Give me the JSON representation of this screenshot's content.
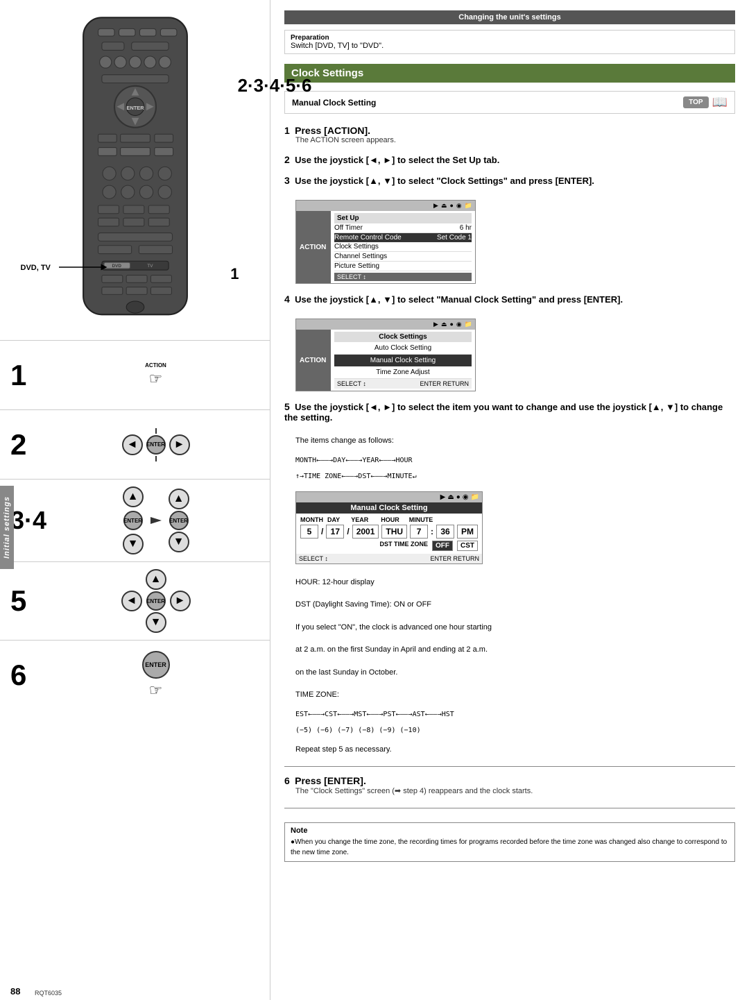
{
  "left": {
    "remote_label": "2·3·4·5·6",
    "dvd_tv": "DVD, TV",
    "step1_label": "1",
    "step2_label": "2",
    "step34_label": "3·4",
    "step5_label": "5",
    "step6_label": "6",
    "page_num": "88",
    "rqt_num": "RQT6035",
    "sidebar_text": "Initial settings"
  },
  "right": {
    "section_header": "Changing the unit's settings",
    "prep_label": "Preparation",
    "prep_text": "Switch [DVD, TV] to \"DVD\".",
    "green_header": "Clock Settings",
    "manual_clock_label": "Manual Clock Setting",
    "top_badge": "TOP",
    "steps": [
      {
        "num": "1",
        "bold": "Press [ACTION].",
        "sub": "The ACTION screen appears."
      },
      {
        "num": "2",
        "bold": "Use the joystick [◄, ►] to select the Set Up tab."
      },
      {
        "num": "3",
        "bold": "Use the joystick [▲, ▼] to select \"Clock Settings\" and press [ENTER]."
      },
      {
        "num": "4",
        "bold": "Use the joystick [▲, ▼] to select \"Manual Clock Setting\" and press [ENTER]."
      },
      {
        "num": "5",
        "bold": "Use the joystick [◄, ►] to select the item you want to change and use the joystick [▲, ▼] to change the setting.",
        "sub1": "The items change as follows:",
        "sub2": "MONTH←——→DAY←——→YEAR←——→HOUR",
        "sub3": "↑→TIME ZONE←——→DST←——→MINUTE↵"
      },
      {
        "num": "6",
        "bold": "Press [ENTER].",
        "sub": "The \"Clock Settings\" screen (➡ step 4) reappears and the clock starts."
      }
    ],
    "screen1": {
      "title": "Set Up",
      "rows": [
        {
          "label": "Off Timer",
          "value": "6 hr"
        },
        {
          "label": "Remote Control Code",
          "value": "Set Code 1",
          "highlight": true
        },
        {
          "label": "Clock Settings",
          "value": ""
        },
        {
          "label": "Channel Settings",
          "value": ""
        },
        {
          "label": "Picture Setting",
          "value": ""
        }
      ]
    },
    "screen2": {
      "title": "Clock Settings",
      "rows": [
        {
          "label": "Auto Clock Setting"
        },
        {
          "label": "Manual Clock Setting"
        },
        {
          "label": "Time Zone Adjust"
        }
      ]
    },
    "mcs_screen": {
      "title": "Manual Clock Setting",
      "col_headers": [
        "MONTH",
        "DAY",
        "YEAR",
        "HOUR",
        "MINUTE"
      ],
      "values": [
        "5",
        "17",
        "2001",
        "THU",
        "7",
        "36",
        "PM"
      ],
      "dst_label": "DST TIME ZONE",
      "dst_val": "OFF",
      "tz_val": "CST"
    },
    "hour_note": "HOUR:  12-hour display",
    "dst_note": "DST (Daylight Saving Time):  ON or OFF",
    "dst_detail1": "If you select \"ON\", the clock is advanced one hour starting",
    "dst_detail2": "at 2 a.m. on the first Sunday in April and ending at 2 a.m.",
    "dst_detail3": "on the last Sunday in October.",
    "tz_label": "TIME ZONE:",
    "tz_row1": "EST←——→CST←——→MST←——→PST←——→AST←——→HST",
    "tz_row2": "(−5)    (−6)    (−7)    (−8)    (−9)    (−10)",
    "repeat_note": "Repeat step 5 as necessary.",
    "note_header": "Note",
    "note_bullet": "●When you change the time zone, the recording times for programs recorded before the time zone was changed also change to correspond to the new time zone."
  }
}
